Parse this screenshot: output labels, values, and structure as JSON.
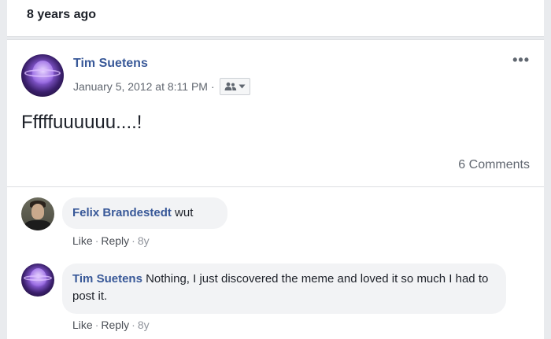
{
  "feed_header": {
    "time_ago": "8 years ago"
  },
  "post": {
    "author": "Tim Suetens",
    "timestamp": "January 5, 2012 at 8:11 PM",
    "separator": "·",
    "audience_icon": "friends-icon",
    "more_icon": "more-icon",
    "more_glyph": "•••",
    "text": "Fffffuuuuuu....!",
    "comments_count": "6 Comments"
  },
  "comments": [
    {
      "author": "Felix Brandestedt",
      "text": "wut",
      "like": "Like",
      "reply": "Reply",
      "age": "8y",
      "dot": "·"
    },
    {
      "author": "Tim Suetens",
      "text": "Nothing, I just discovered the meme and loved it so much I had to post it.",
      "like": "Like",
      "reply": "Reply",
      "age": "8y",
      "dot": "·"
    }
  ],
  "colors": {
    "link_blue": "#385898",
    "muted_gray": "#616770",
    "bubble_bg": "#f2f3f5",
    "page_bg": "#e9ebee"
  }
}
